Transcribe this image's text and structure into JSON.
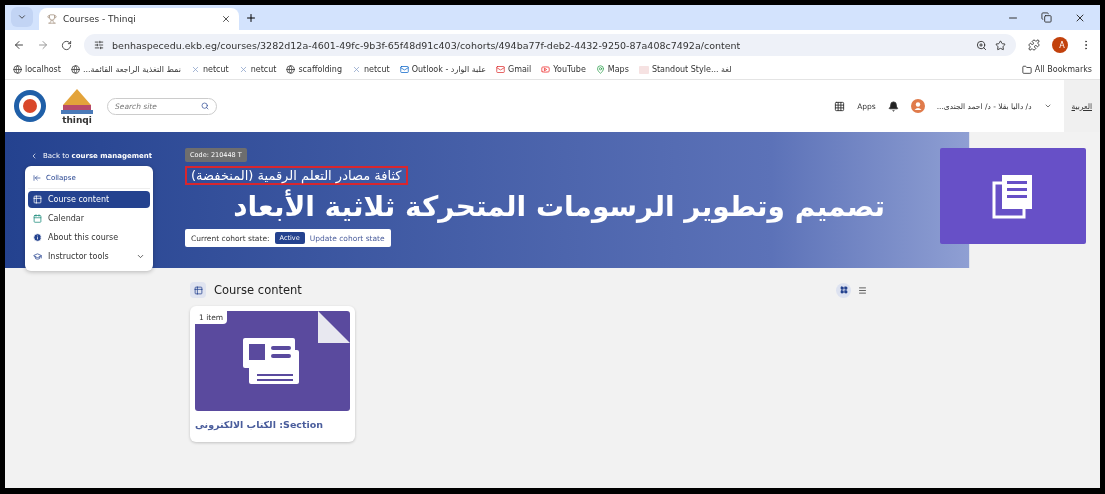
{
  "browser": {
    "tab_title": "Courses - Thinqi",
    "url": "benhaspecedu.ekb.eg/courses/3282d12a-4601-49fc-9b3f-65f48d91c403/cohorts/494ba77f-deb2-4432-9250-87a408c7492a/content",
    "profile_initial": "A",
    "all_bookmarks": "All Bookmarks",
    "bookmarks": [
      {
        "label": "localhost",
        "kind": "globe"
      },
      {
        "label": "نمط التغذية الراجعة القائمة...",
        "kind": "globe"
      },
      {
        "label": "netcut",
        "kind": "x"
      },
      {
        "label": "netcut",
        "kind": "x"
      },
      {
        "label": "scaffolding",
        "kind": "globe"
      },
      {
        "label": "netcut",
        "kind": "x"
      },
      {
        "label": "Outlook - علبة الوارد",
        "kind": "outlook"
      },
      {
        "label": "Gmail",
        "kind": "gmail"
      },
      {
        "label": "YouTube",
        "kind": "youtube"
      },
      {
        "label": "Maps",
        "kind": "maps"
      },
      {
        "label": "Standout Style... لغة",
        "kind": "ve"
      }
    ]
  },
  "site_header": {
    "logo_caption": "thinqi",
    "search": {
      "placeholder": "Search site"
    },
    "apps": "Apps",
    "user": "د/ داليا بقلا - د/ احمد الجندى...",
    "language": "العربية"
  },
  "sidebar": {
    "back_link": "Back to **course management**",
    "collapse": "Collapse",
    "items": [
      {
        "label": "Course content",
        "kind": "content",
        "selected": true
      },
      {
        "label": "Calendar",
        "kind": "calendar",
        "selected": false
      },
      {
        "label": "About this course",
        "kind": "about",
        "selected": false
      },
      {
        "label": "Instructor tools",
        "kind": "tools",
        "selected": false,
        "expanded": false
      }
    ]
  },
  "banner": {
    "code": "Code: 210448 T",
    "subtitle": "كثافة مصادر التعلم الرقمية (المنخفضة)",
    "title": "تصميم وتطوير الرسومات المتحركة ثلاثية الأبعاد",
    "cohort_label": "Current cohort state:",
    "cohort_state": "Active",
    "update_label": "Update cohort state"
  },
  "content": {
    "heading": "Course content",
    "view_modes": [
      {
        "kind": "grid",
        "selected": true
      },
      {
        "kind": "list",
        "selected": false
      }
    ],
    "cards": [
      {
        "badge": "1 item",
        "title": "Section: الكتاب الالكترونى"
      }
    ]
  }
}
